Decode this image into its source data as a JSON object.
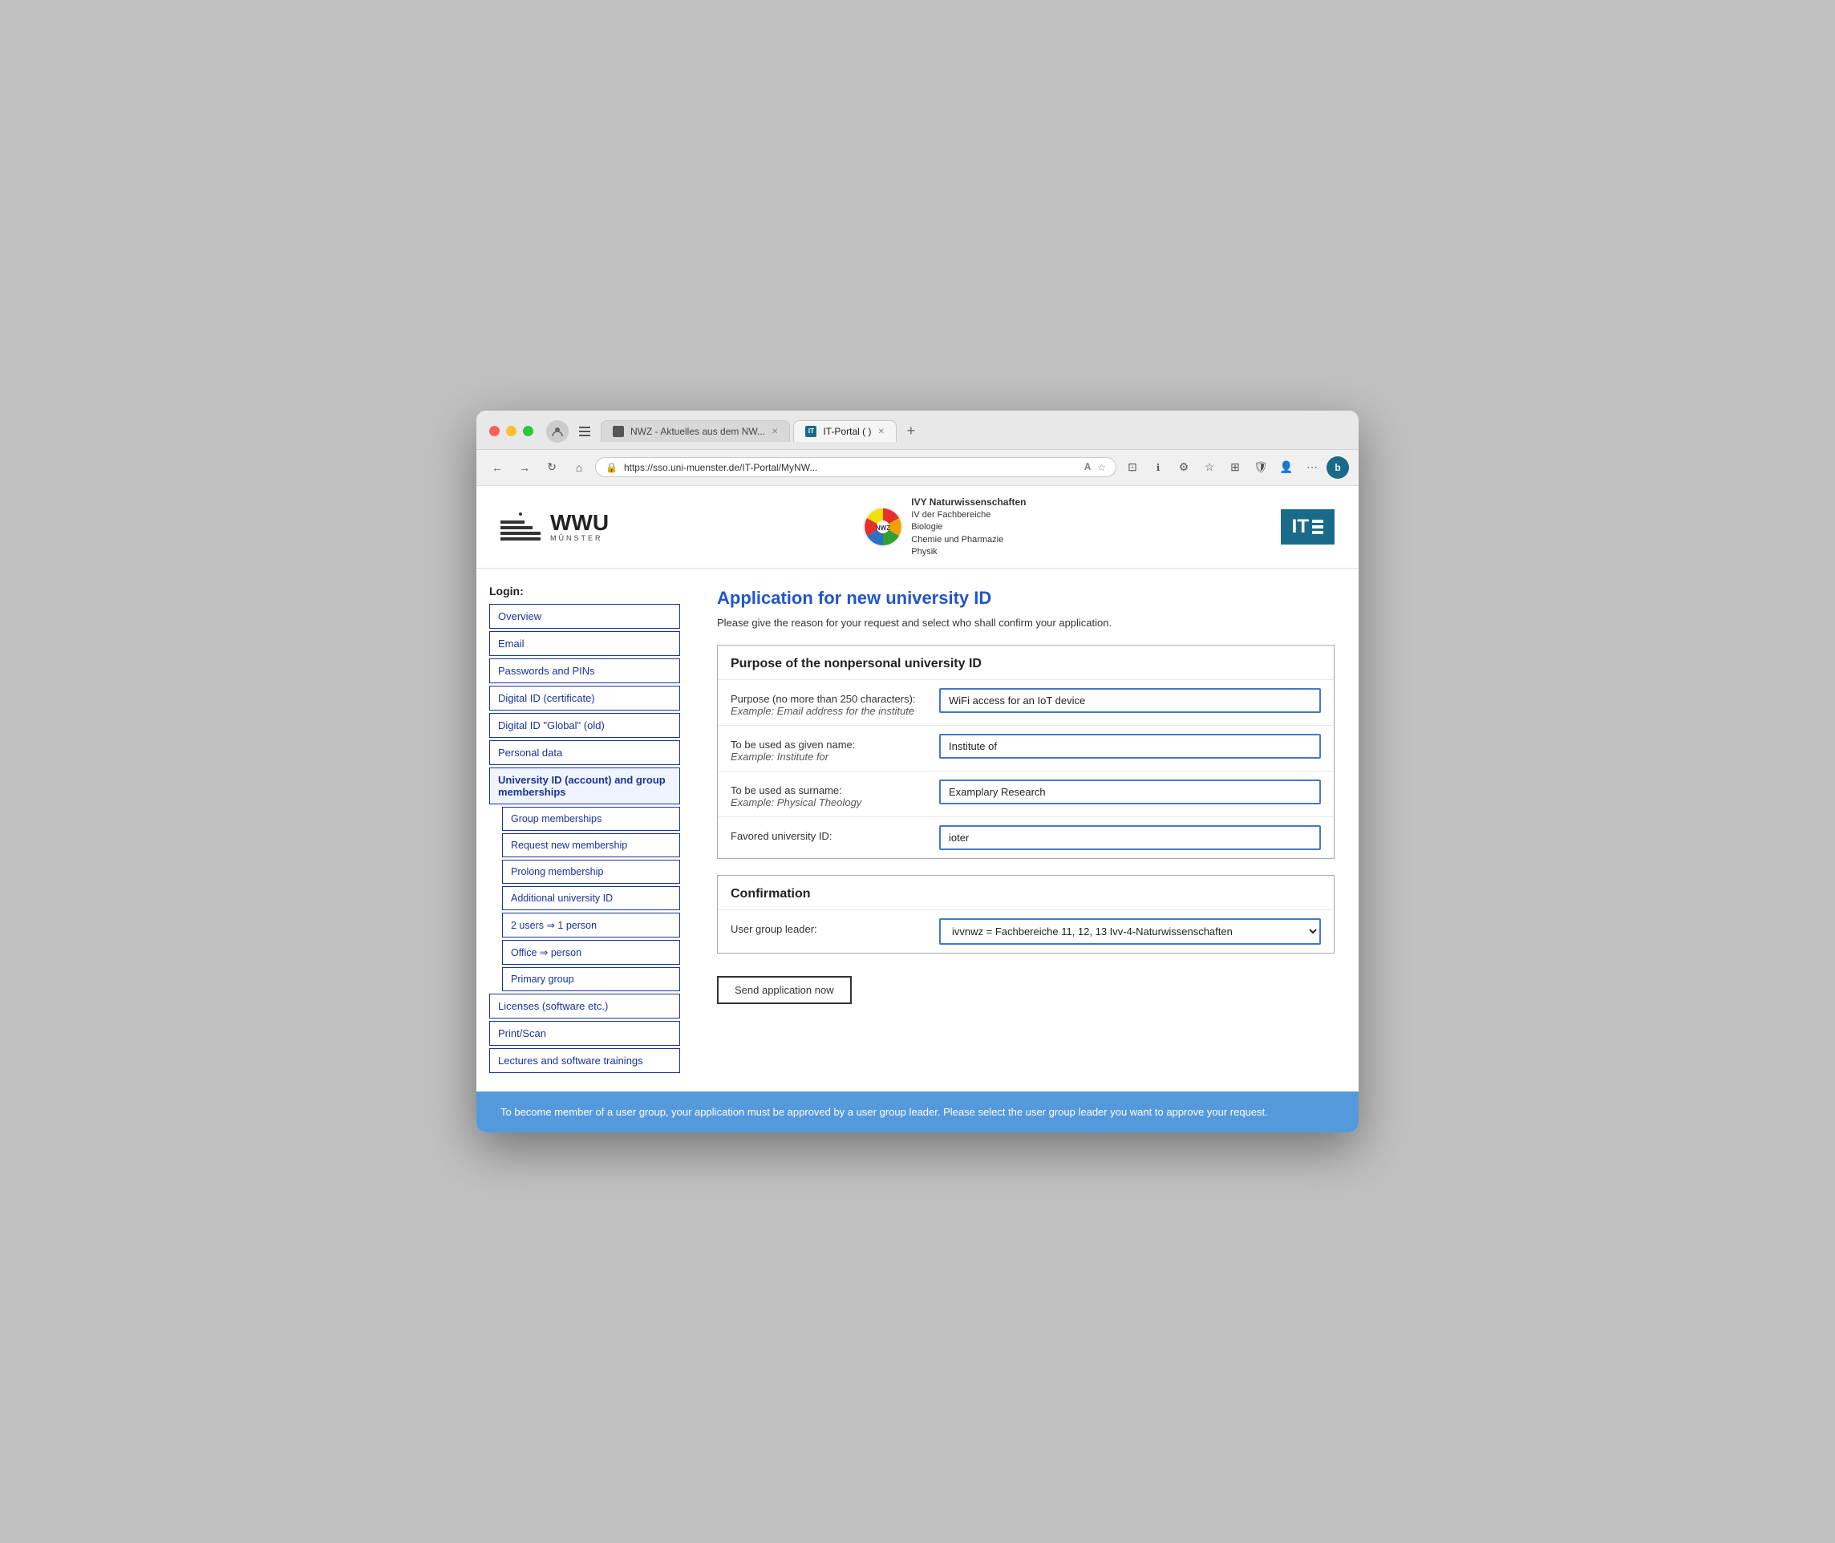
{
  "browser": {
    "tab1_label": "NWZ - Aktuelles aus dem NW...",
    "tab2_label": "IT-Portal (         )",
    "tab2_active": true,
    "address": "https://sso.uni-muenster.de/IT-Portal/MyNW...",
    "new_tab_label": "+"
  },
  "header": {
    "wwu_title": "WWU",
    "wwu_subtitle": "MÜNSTER",
    "center_org_line1": "IVY Naturwissenschaften",
    "center_org_line2": "IV der Fachbereiche",
    "center_org_line3": "Biologie",
    "center_org_line4": "Chemie und Pharmazie",
    "center_org_line5": "Physik",
    "center_org_abbr": "NWZ",
    "it_logo": "IT"
  },
  "sidebar": {
    "login_label": "Login:",
    "items": [
      {
        "label": "Overview",
        "active": false,
        "sub": false
      },
      {
        "label": "Email",
        "active": false,
        "sub": false
      },
      {
        "label": "Passwords and PINs",
        "active": false,
        "sub": false
      },
      {
        "label": "Digital ID (certificate)",
        "active": false,
        "sub": false
      },
      {
        "label": "Digital ID \"Global\" (old)",
        "active": false,
        "sub": false
      },
      {
        "label": "Personal data",
        "active": false,
        "sub": false
      },
      {
        "label": "University ID (account) and group memberships",
        "active": true,
        "sub": false
      },
      {
        "label": "Group memberships",
        "active": false,
        "sub": true
      },
      {
        "label": "Request new membership",
        "active": false,
        "sub": true
      },
      {
        "label": "Prolong membership",
        "active": false,
        "sub": true
      },
      {
        "label": "Additional university ID",
        "active": false,
        "sub": true
      },
      {
        "label": "2 users ⇒ 1 person",
        "active": false,
        "sub": true
      },
      {
        "label": "Office ⇒ person",
        "active": false,
        "sub": true
      },
      {
        "label": "Primary group",
        "active": false,
        "sub": true
      },
      {
        "label": "Licenses (software etc.)",
        "active": false,
        "sub": false
      },
      {
        "label": "Print/Scan",
        "active": false,
        "sub": false
      },
      {
        "label": "Lectures and software trainings",
        "active": false,
        "sub": false
      }
    ]
  },
  "page": {
    "title": "Application for new university ID",
    "subtitle": "Please give the reason for your request and select who shall confirm your application.",
    "section1_title": "Purpose of the nonpersonal university ID",
    "field1_label": "Purpose (no more than 250 characters):",
    "field1_example": "Example: Email address for the institute",
    "field1_value": "WiFi access for an IoT device",
    "field2_label": "To be used as given name:",
    "field2_example": "Example: Institute for",
    "field2_value": "Institute of",
    "field3_label": "To be used as surname:",
    "field3_example": "Example: Physical Theology",
    "field3_value": "Examplary Research",
    "field4_label": "Favored university ID:",
    "field4_value": "ioter",
    "section2_title": "Confirmation",
    "field5_label": "User group leader:",
    "field5_value": "ivvnwz = Fachbereiche 11, 12, 13 Ivv-4-Naturwissenschaften",
    "submit_label": "Send application now",
    "bottom_banner": "To become member of a user group, your application must be approved by a user group leader. Please select the user group leader you want to approve your request."
  }
}
